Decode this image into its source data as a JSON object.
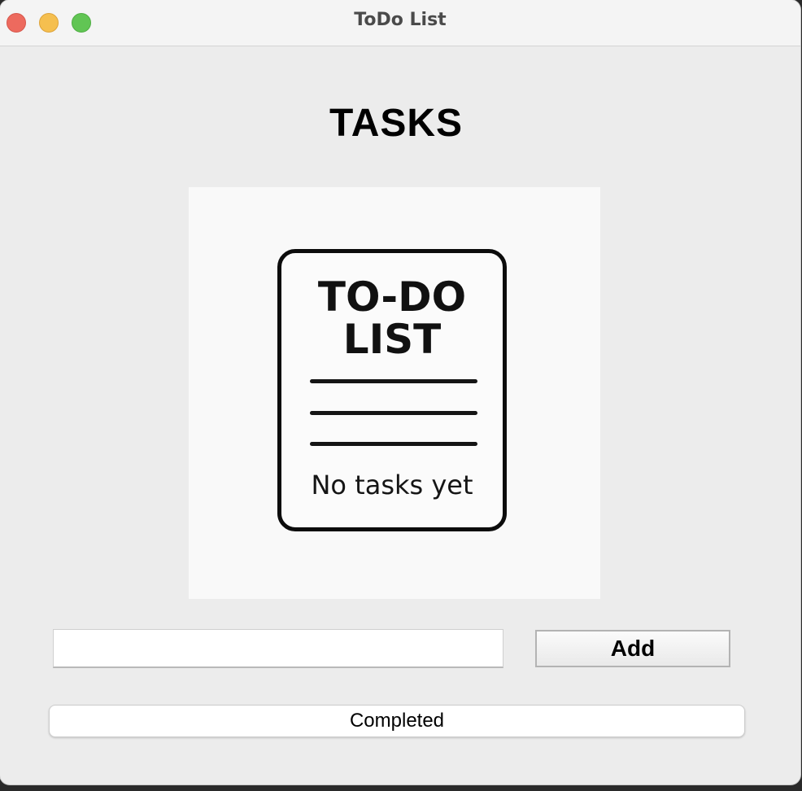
{
  "window": {
    "title": "ToDo List",
    "controls": [
      "close",
      "minimize",
      "zoom"
    ]
  },
  "main": {
    "heading": "TASKS",
    "illustration": {
      "icon": "todo-list-document-icon",
      "title": "TO-DO\nLIST",
      "caption": "No tasks yet"
    },
    "task_input": {
      "value": "",
      "placeholder": ""
    },
    "add_label": "Add",
    "completed_label": "Completed"
  },
  "colors": {
    "window_background": "#ececec",
    "close": "#ed6a5e",
    "minimize": "#f5bf4f",
    "zoom": "#61c554"
  }
}
